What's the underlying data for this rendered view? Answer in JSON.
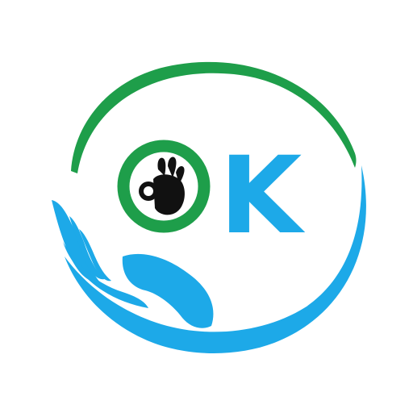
{
  "logo": {
    "text": "K",
    "colors": {
      "green": "#1e9e4a",
      "blue": "#1da9e8",
      "black": "#111111",
      "background": "#ffffff"
    },
    "icons": {
      "ring": "green-ring-icon",
      "hand_sign": "ok-hand-sign-icon",
      "caring_hand": "caring-hand-icon",
      "arc": "green-arc-icon"
    }
  }
}
